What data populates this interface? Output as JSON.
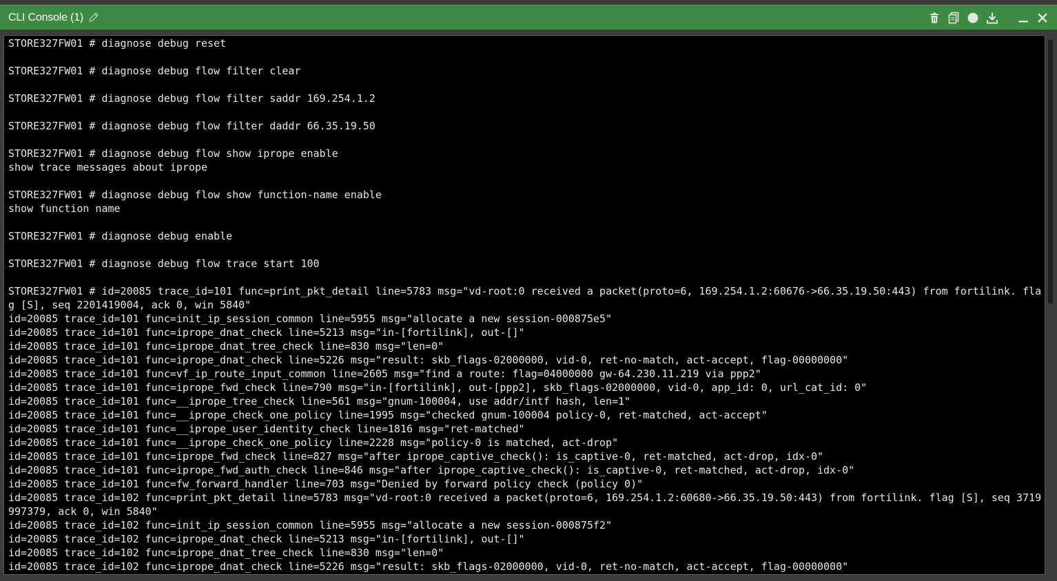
{
  "window": {
    "title": "CLI Console (1)"
  },
  "toolbar": {
    "icons": [
      "trash-icon",
      "copy-icon",
      "record-icon",
      "download-icon",
      "minimize-icon",
      "close-icon"
    ]
  },
  "colors": {
    "titlebar": "#3e8a42",
    "console_bg": "#000000",
    "console_text": "#e6e6e6"
  },
  "console": {
    "lines": [
      "STORE327FW01 # diagnose debug reset",
      "",
      "STORE327FW01 # diagnose debug flow filter clear",
      "",
      "STORE327FW01 # diagnose debug flow filter saddr 169.254.1.2",
      "",
      "STORE327FW01 # diagnose debug flow filter daddr 66.35.19.50",
      "",
      "STORE327FW01 # diagnose debug flow show iprope enable",
      "show trace messages about iprope",
      "",
      "STORE327FW01 # diagnose debug flow show function-name enable",
      "show function name",
      "",
      "STORE327FW01 # diagnose debug enable",
      "",
      "STORE327FW01 # diagnose debug flow trace start 100",
      "",
      "STORE327FW01 # id=20085 trace_id=101 func=print_pkt_detail line=5783 msg=\"vd-root:0 received a packet(proto=6, 169.254.1.2:60676->66.35.19.50:443) from fortilink. flag [S], seq 2201419004, ack 0, win 5840\"",
      "id=20085 trace_id=101 func=init_ip_session_common line=5955 msg=\"allocate a new session-000875e5\"",
      "id=20085 trace_id=101 func=iprope_dnat_check line=5213 msg=\"in-[fortilink], out-[]\"",
      "id=20085 trace_id=101 func=iprope_dnat_tree_check line=830 msg=\"len=0\"",
      "id=20085 trace_id=101 func=iprope_dnat_check line=5226 msg=\"result: skb_flags-02000000, vid-0, ret-no-match, act-accept, flag-00000000\"",
      "id=20085 trace_id=101 func=vf_ip_route_input_common line=2605 msg=\"find a route: flag=04000000 gw-64.230.11.219 via ppp2\"",
      "id=20085 trace_id=101 func=iprope_fwd_check line=790 msg=\"in-[fortilink], out-[ppp2], skb_flags-02000000, vid-0, app_id: 0, url_cat_id: 0\"",
      "id=20085 trace_id=101 func=__iprope_tree_check line=561 msg=\"gnum-100004, use addr/intf hash, len=1\"",
      "id=20085 trace_id=101 func=__iprope_check_one_policy line=1995 msg=\"checked gnum-100004 policy-0, ret-matched, act-accept\"",
      "id=20085 trace_id=101 func=__iprope_user_identity_check line=1816 msg=\"ret-matched\"",
      "id=20085 trace_id=101 func=__iprope_check_one_policy line=2228 msg=\"policy-0 is matched, act-drop\"",
      "id=20085 trace_id=101 func=iprope_fwd_check line=827 msg=\"after iprope_captive_check(): is_captive-0, ret-matched, act-drop, idx-0\"",
      "id=20085 trace_id=101 func=iprope_fwd_auth_check line=846 msg=\"after iprope_captive_check(): is_captive-0, ret-matched, act-drop, idx-0\"",
      "id=20085 trace_id=101 func=fw_forward_handler line=703 msg=\"Denied by forward policy check (policy 0)\"",
      "id=20085 trace_id=102 func=print_pkt_detail line=5783 msg=\"vd-root:0 received a packet(proto=6, 169.254.1.2:60680->66.35.19.50:443) from fortilink. flag [S], seq 3719997379, ack 0, win 5840\"",
      "id=20085 trace_id=102 func=init_ip_session_common line=5955 msg=\"allocate a new session-000875f2\"",
      "id=20085 trace_id=102 func=iprope_dnat_check line=5213 msg=\"in-[fortilink], out-[]\"",
      "id=20085 trace_id=102 func=iprope_dnat_tree_check line=830 msg=\"len=0\"",
      "id=20085 trace_id=102 func=iprope_dnat_check line=5226 msg=\"result: skb_flags-02000000, vid-0, ret-no-match, act-accept, flag-00000000\""
    ]
  }
}
